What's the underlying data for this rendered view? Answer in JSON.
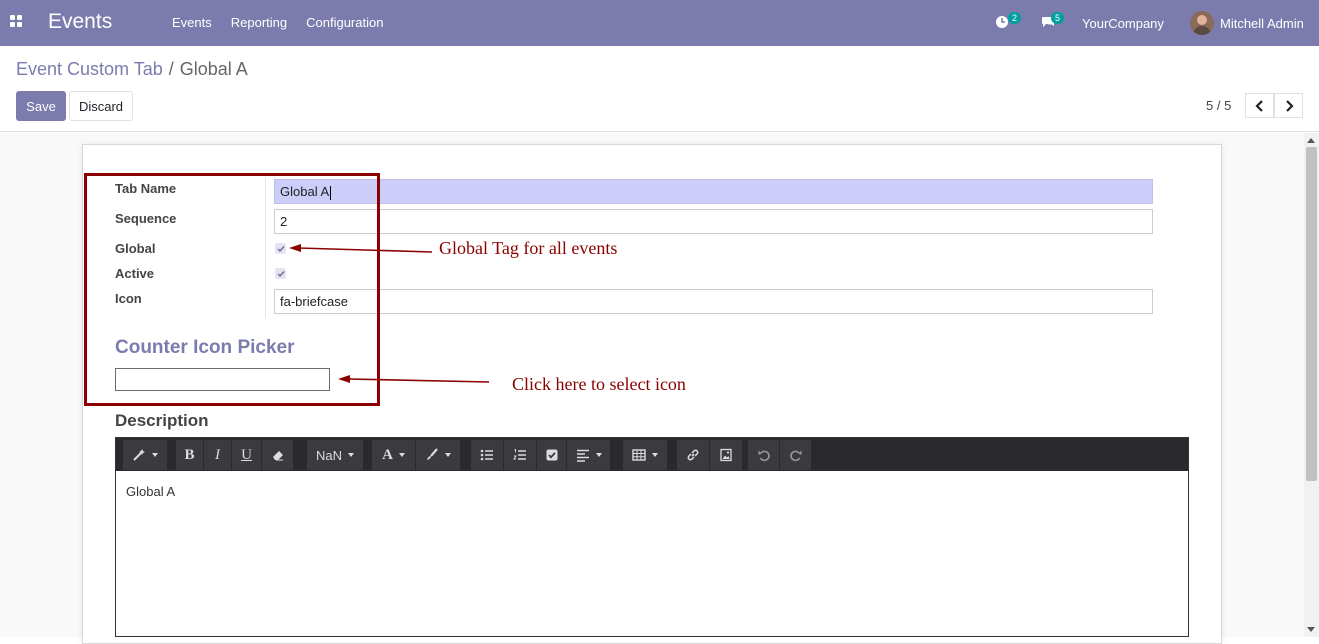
{
  "navbar": {
    "app_title": "Events",
    "menu": [
      "Events",
      "Reporting",
      "Configuration"
    ],
    "activity_count": "2",
    "messages_count": "5",
    "company": "YourCompany",
    "user": "Mitchell Admin",
    "color": "#7c7bad"
  },
  "control": {
    "breadcrumb_parent": "Event Custom Tab",
    "breadcrumb_sep": "/",
    "breadcrumb_current": "Global A",
    "save_label": "Save",
    "discard_label": "Discard",
    "pager": "5 / 5"
  },
  "form": {
    "tab_name_label": "Tab Name",
    "tab_name_value": "Global A",
    "sequence_label": "Sequence",
    "sequence_value": "2",
    "global_label": "Global",
    "global_checked": true,
    "active_label": "Active",
    "active_checked": true,
    "icon_label": "Icon",
    "icon_value": "fa-briefcase",
    "counter_icon_title": "Counter Icon Picker",
    "counter_icon_value": "",
    "description_title": "Description",
    "description_text": "Global A"
  },
  "editor": {
    "font_size_label": "NaN",
    "bold": "B",
    "italic": "I",
    "underline": "U",
    "font_color": "A"
  },
  "annotations": {
    "global_note": "Global Tag for all events",
    "picker_note": "Click here to select icon",
    "color": "#8b0000"
  }
}
